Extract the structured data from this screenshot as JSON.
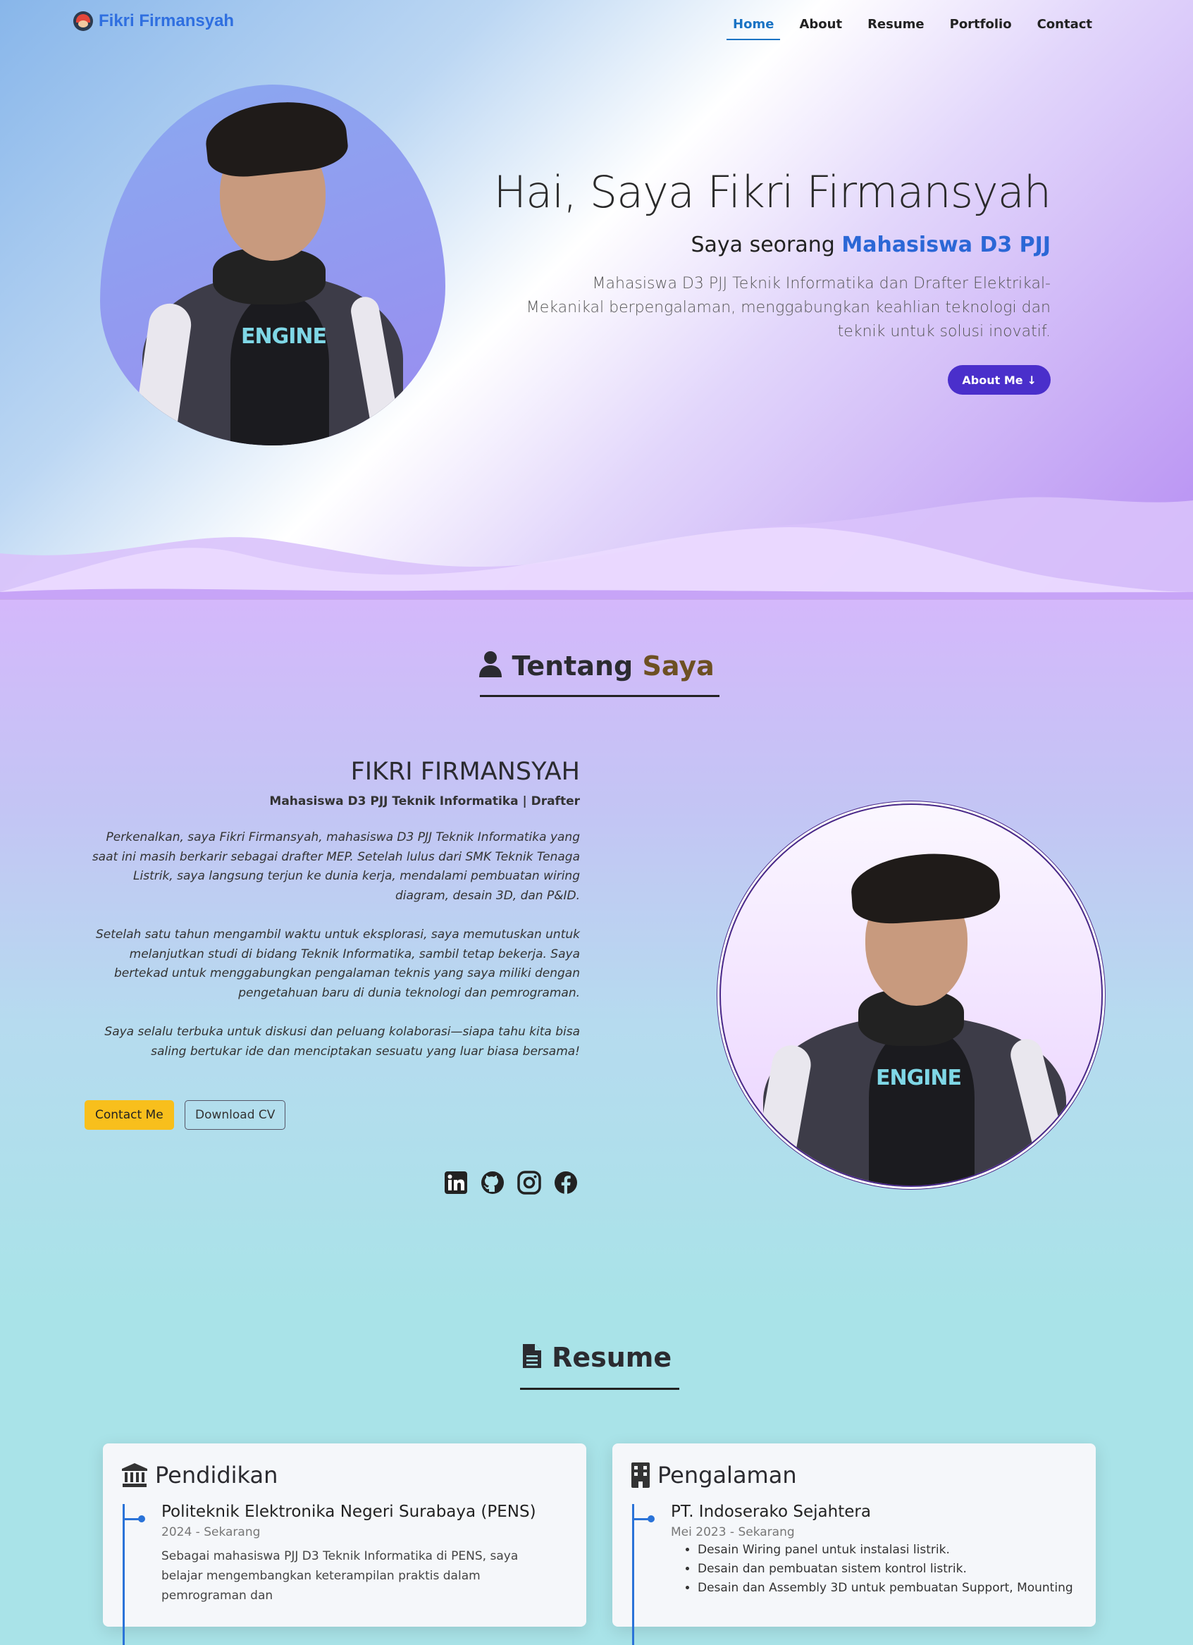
{
  "nav": {
    "brand": "Fikri Firmansyah",
    "links": [
      "Home",
      "About",
      "Resume",
      "Portfolio",
      "Contact"
    ],
    "active": "Home"
  },
  "hero": {
    "title": "Hai, Saya Fikri Firmansyah",
    "subtitle_prefix": "Saya seorang",
    "subtitle_accent": "Mahasiswa D3 PJJ",
    "description": "Mahasiswa D3 PJJ Teknik Informatika dan Drafter Elektrikal-Mekanikal berpengalaman, menggabungkan keahlian teknologi dan teknik untuk solusi inovatif.",
    "button": "About Me",
    "button_icon": "arrow-down-icon",
    "shirt_text": "ENGINE"
  },
  "about": {
    "title_part1": "Tentang",
    "title_part2": "Saya",
    "title_icon": "user-icon",
    "name": "FIKRI FIRMANSYAH",
    "role": "Mahasiswa D3 PJJ Teknik Informatika | Drafter",
    "paragraphs": [
      "Perkenalkan, saya Fikri Firmansyah, mahasiswa D3 PJJ Teknik Informatika yang saat ini masih berkarir sebagai drafter MEP. Setelah lulus dari SMK Teknik Tenaga Listrik, saya langsung terjun ke dunia kerja, mendalami pembuatan wiring diagram, desain 3D, dan P&ID.",
      "Setelah satu tahun mengambil waktu untuk eksplorasi, saya memutuskan untuk melanjutkan studi di bidang Teknik Informatika, sambil tetap bekerja. Saya bertekad untuk menggabungkan pengalaman teknis yang saya miliki dengan pengetahuan baru di dunia teknologi dan pemrograman.",
      "Saya selalu terbuka untuk diskusi dan peluang kolaborasi—siapa tahu kita bisa saling bertukar ide dan menciptakan sesuatu yang luar biasa bersama!"
    ],
    "contact_button": "Contact Me",
    "cv_button": "Download CV",
    "socials": [
      "linkedin-icon",
      "github-icon",
      "instagram-icon",
      "facebook-icon"
    ]
  },
  "resume": {
    "title": "Resume",
    "title_icon": "document-icon",
    "education": {
      "heading": "Pendidikan",
      "icon": "institution-icon",
      "item_title": "Politeknik Elektronika Negeri Surabaya (PENS)",
      "item_date": "2024 - Sekarang",
      "item_text": "Sebagai mahasiswa PJJ D3 Teknik Informatika di PENS, saya belajar mengembangkan keterampilan praktis dalam pemrograman dan"
    },
    "experience": {
      "heading": "Pengalaman",
      "icon": "building-icon",
      "item_title": "PT. Indoserako Sejahtera",
      "item_date": "Mei 2023 - Sekarang",
      "bullets": [
        "Desain Wiring panel untuk instalasi listrik.",
        "Desain dan pembuatan sistem kontrol listrik.",
        "Desain dan Assembly 3D untuk pembuatan Support, Mounting"
      ]
    }
  },
  "colors": {
    "accent_blue": "#2b67d6",
    "button_purple": "#4a2fcb",
    "contact_yellow": "#f8bf1c",
    "title_gold": "#6d5023",
    "timeline_blue": "#2a73d8"
  }
}
